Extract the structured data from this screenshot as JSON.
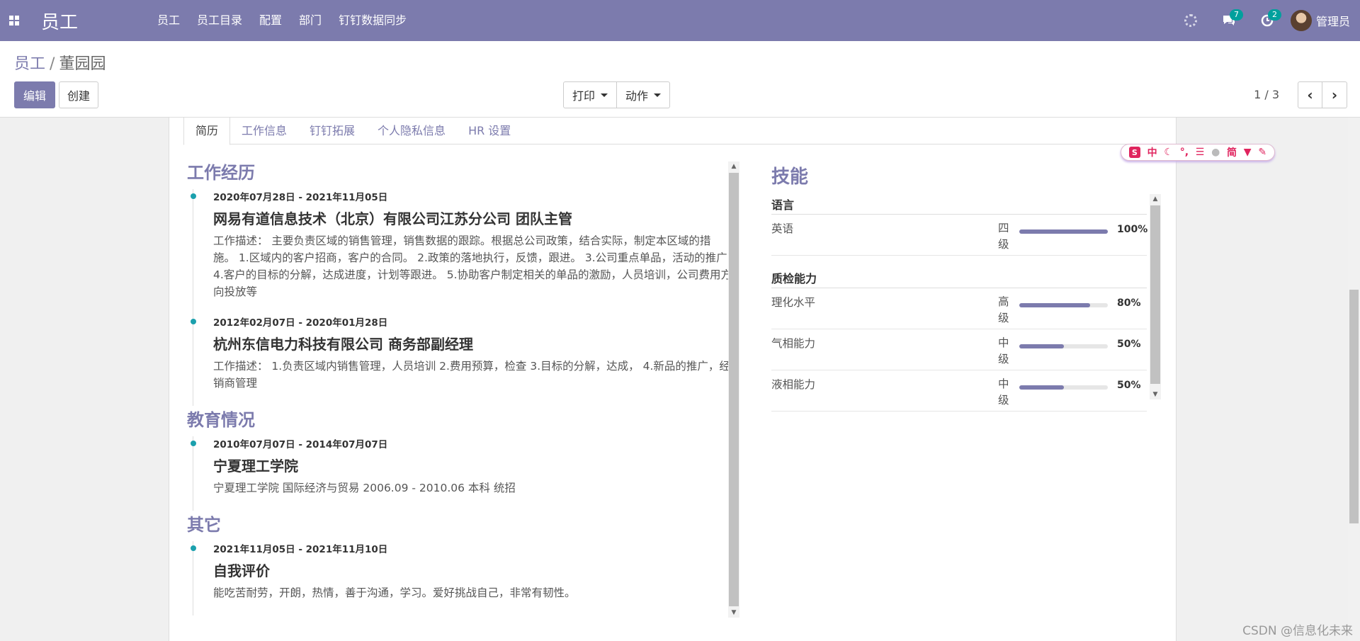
{
  "navbar": {
    "brand": "员工",
    "menu": [
      "员工",
      "员工目录",
      "配置",
      "部门",
      "钉钉数据同步"
    ],
    "chat_badge": "7",
    "activity_badge": "2",
    "user": "管理员"
  },
  "breadcrumb": {
    "parent": "员工",
    "separator": "/",
    "current": "董园园"
  },
  "buttons": {
    "edit": "编辑",
    "create": "创建",
    "print": "打印",
    "action": "动作"
  },
  "pager": {
    "value": "1 / 3"
  },
  "tabs": [
    "简历",
    "工作信息",
    "钉钉拓展",
    "个人隐私信息",
    "HR 设置"
  ],
  "resume": {
    "work_title": "工作经历",
    "work": [
      {
        "date": "2020年07月28日 - 2021年11月05日",
        "title": "网易有道信息技术（北京）有限公司江苏分公司 团队主管",
        "desc": "工作描述： 主要负责区域的销售管理，销售数据的跟踪。根据总公司政策，结合实际，制定本区域的措施。 1.区域内的客户招商，客户的合同。 2.政策的落地执行，反馈，跟进。 3.公司重点单品，活动的推广 4.客户的目标的分解，达成进度，计划等跟进。 5.协助客户制定相关的单品的激励，人员培训，公司费用方向投放等"
      },
      {
        "date": "2012年02月07日 - 2020年01月28日",
        "title": "杭州东信电力科技有限公司 商务部副经理",
        "desc": "工作描述： 1.负责区域内销售管理，人员培训 2.费用预算，检查 3.目标的分解，达成， 4.新品的推广，经销商管理"
      }
    ],
    "edu_title": "教育情况",
    "edu": [
      {
        "date": "2010年07月07日 - 2014年07月07日",
        "title": "宁夏理工学院",
        "desc": "宁夏理工学院 国际经济与贸易 2006.09 - 2010.06 本科 统招"
      }
    ],
    "other_title": "其它",
    "other": [
      {
        "date": "2021年11月05日 - 2021年11月10日",
        "title": "自我评价",
        "desc": "能吃苦耐劳，开朗，热情，善于沟通，学习。爱好挑战自己，非常有韧性。"
      }
    ]
  },
  "skills": {
    "title": "技能",
    "categories": [
      {
        "name": "语言",
        "items": [
          {
            "name": "英语",
            "level": "四级",
            "pct": 100,
            "pct_label": "100%"
          }
        ]
      },
      {
        "name": "质检能力",
        "items": [
          {
            "name": "理化水平",
            "level": "高级",
            "pct": 80,
            "pct_label": "80%"
          },
          {
            "name": "气相能力",
            "level": "中级",
            "pct": 50,
            "pct_label": "50%"
          },
          {
            "name": "液相能力",
            "level": "中级",
            "pct": 50,
            "pct_label": "50%"
          }
        ]
      }
    ]
  },
  "ime": [
    "中",
    "简"
  ],
  "watermark": "CSDN @信息化未来"
}
